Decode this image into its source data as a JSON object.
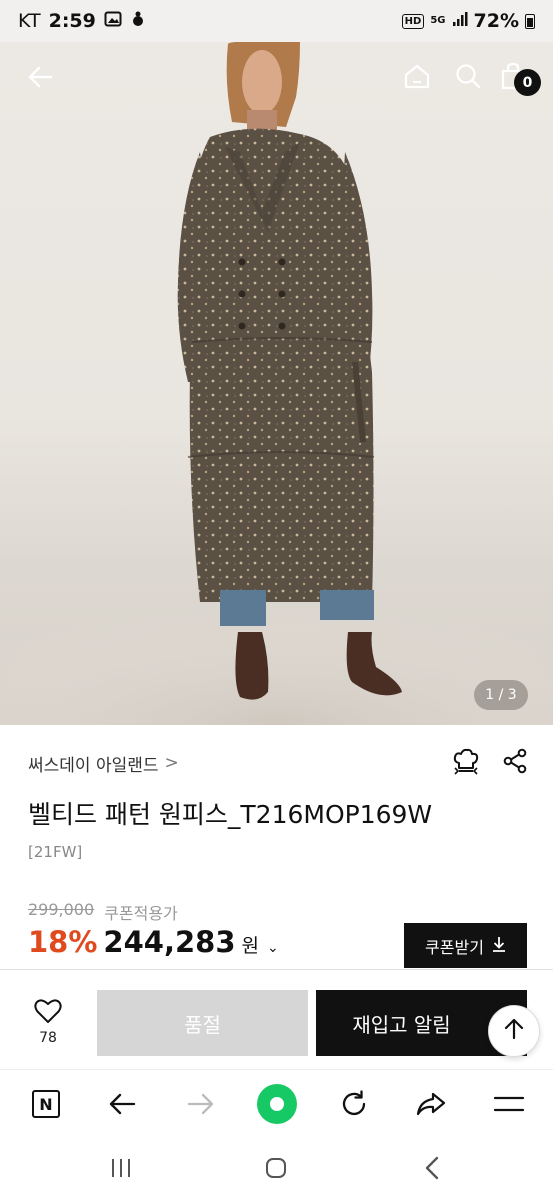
{
  "status_bar": {
    "carrier": "KT",
    "time": "2:59",
    "hd_label": "HD",
    "network_label": "5G",
    "battery": "72%"
  },
  "header_icons": [
    "back-arrow-icon",
    "home-icon",
    "search-icon",
    "cart-icon"
  ],
  "cart": {
    "count": "0"
  },
  "gallery": {
    "pager": "1 / 3"
  },
  "product": {
    "brand": "써스데이 아일랜드",
    "brand_chevron": ">",
    "title": "벨티드 패턴 원피스_T216MOP169W",
    "season": "[21FW]",
    "original_price": "299,000",
    "coupon_note": "쿠폰적용가",
    "discount": "18%",
    "price": "244,283",
    "currency": "원",
    "currency_chevron": "⌄",
    "coupon_button": "쿠폰받기"
  },
  "actions": {
    "like_count": "78",
    "soldout_label": "품절",
    "restock_label": "재입고 알림"
  },
  "browser_toolbar": {
    "n_label": "N",
    "icons": [
      "n-logo-icon",
      "back-icon",
      "forward-icon",
      "green-home-icon",
      "refresh-icon",
      "share-icon",
      "menu-icon"
    ]
  },
  "system_nav": {
    "icons": [
      "recents-icon",
      "home-icon",
      "back-icon"
    ]
  },
  "colors": {
    "discount": "#e04a1f",
    "dark_button": "#111111",
    "soldout_button": "#d6d6d6",
    "green_button": "#17c964"
  }
}
